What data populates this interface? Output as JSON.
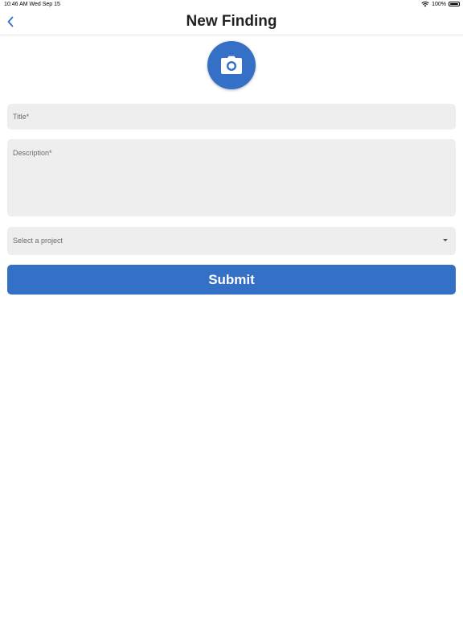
{
  "status_bar": {
    "time_date": "10:46 AM   Wed Sep 15",
    "battery_text": "100%",
    "battery_level": 1.0,
    "wifi_icon": "wifi-icon",
    "battery_icon": "battery-icon"
  },
  "nav": {
    "title": "New Finding",
    "back_icon": "chevron-left-icon"
  },
  "camera": {
    "icon": "camera-icon",
    "color": "#3470c6"
  },
  "form": {
    "title_placeholder": "Title*",
    "description_placeholder": "Description*",
    "project_placeholder": "Select a project",
    "submit_label": "Submit"
  },
  "colors": {
    "accent": "#3470c6",
    "field_bg": "#eeeeee",
    "placeholder_text": "#6b6b6b"
  }
}
